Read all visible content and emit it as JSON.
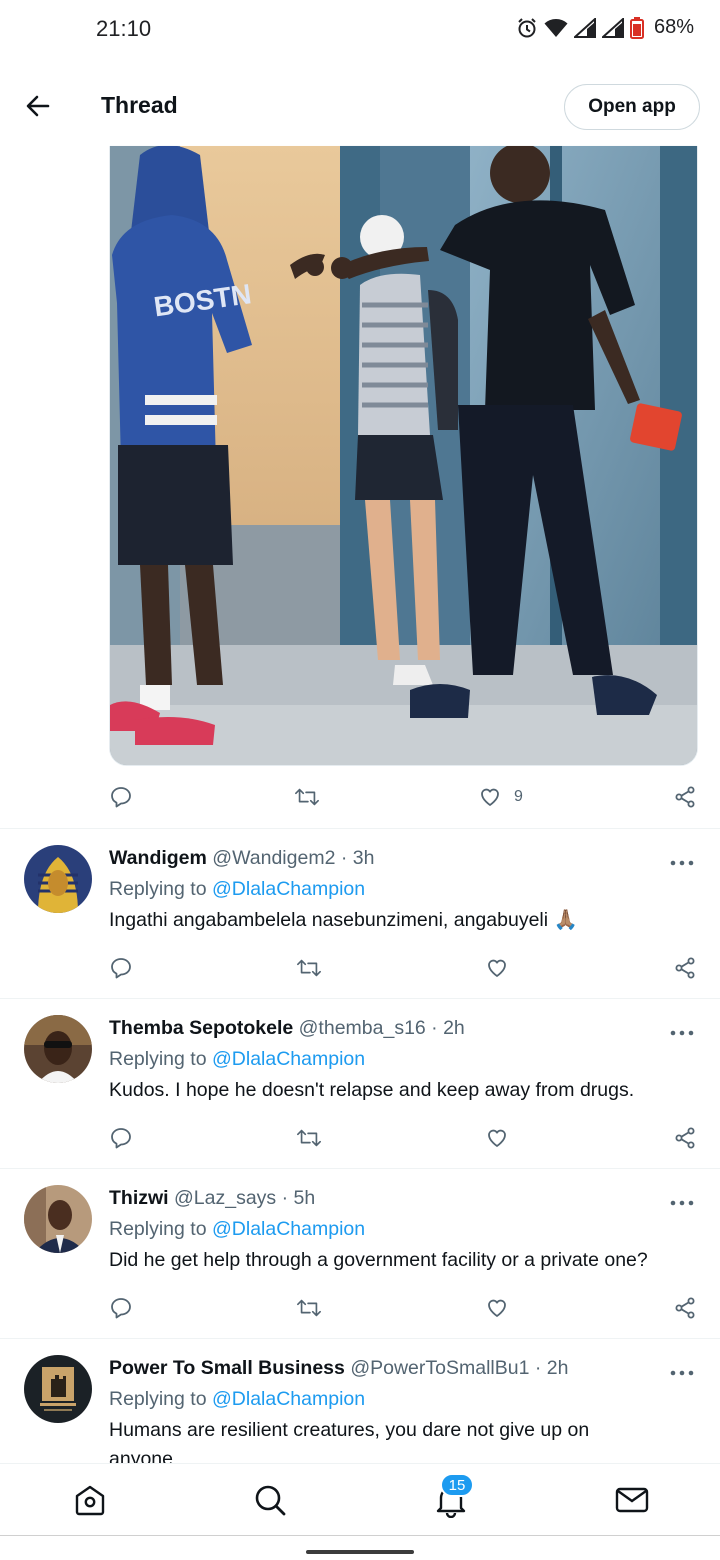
{
  "status_bar": {
    "time": "21:10",
    "battery": "68%"
  },
  "header": {
    "title": "Thread",
    "open_app_label": "Open app"
  },
  "main_tweet": {
    "like_count": "9"
  },
  "replies": [
    {
      "name": "Wandigem",
      "handle": "@Wandigem2 · 3h",
      "replying_prefix": "Replying to ",
      "replying_to": "@DlalaChampion",
      "text": "Ingathi angabambelela nasebunzimeni, angabuyeli 🙏🏽"
    },
    {
      "name": "Themba Sepotokele",
      "handle": "@themba_s16 · 2h",
      "replying_prefix": "Replying to ",
      "replying_to": "@DlalaChampion",
      "text": "Kudos. I hope he doesn't relapse and keep away from drugs."
    },
    {
      "name": "Thizwi",
      "handle": "@Laz_says · 5h",
      "replying_prefix": "Replying to ",
      "replying_to": "@DlalaChampion",
      "text": "Did he get help through a government facility or a private one?"
    },
    {
      "name": "Power To Small Business",
      "handle": "@PowerToSmallBu1 · 2h",
      "replying_prefix": "Replying to ",
      "replying_to": "@DlalaChampion",
      "text": "Humans are resilient creatures, you dare not give up on anyone"
    }
  ],
  "bottom_nav": {
    "notifications_badge": "15"
  },
  "colors": {
    "accent": "#1d9bf0",
    "text": "#0f1419",
    "secondary": "#536471"
  }
}
